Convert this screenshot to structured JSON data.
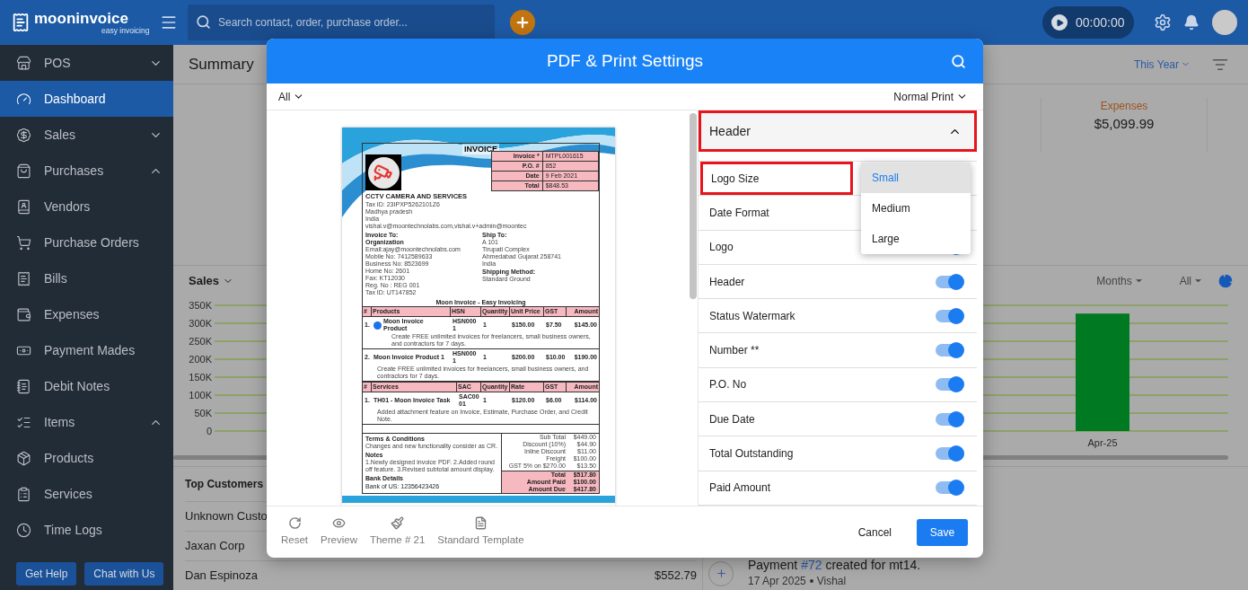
{
  "topbar": {
    "logo_name": "mooninvoice",
    "logo_tagline": "easy invoicing",
    "search_placeholder": "Search contact, order, purchase order...",
    "timer": "00:00:00"
  },
  "sidebar": {
    "items": [
      {
        "label": "POS",
        "expanded": false,
        "selected": false
      },
      {
        "label": "Dashboard",
        "selected": true
      },
      {
        "label": "Sales",
        "expanded": false,
        "selected": false
      },
      {
        "label": "Purchases",
        "expanded": true,
        "selected": false,
        "children": [
          {
            "label": "Vendors",
            "selected": false
          },
          {
            "label": "Purchase Orders",
            "selected": false
          },
          {
            "label": "Bills",
            "selected": false
          },
          {
            "label": "Expenses",
            "selected": false
          },
          {
            "label": "Payment Mades",
            "selected": false
          },
          {
            "label": "Debit Notes",
            "selected": false
          }
        ]
      },
      {
        "label": "Items",
        "expanded": true,
        "selected": false,
        "children": [
          {
            "label": "Products",
            "selected": false
          },
          {
            "label": "Services",
            "selected": false
          },
          {
            "label": "Time Logs",
            "selected": false
          }
        ]
      }
    ],
    "buttons": [
      "Get Help",
      "Chat with Us"
    ]
  },
  "summary": {
    "title": "Summary",
    "period": "This Year",
    "stats": [
      {
        "label": "Expenses",
        "value": "$5,099.99"
      }
    ]
  },
  "sales": {
    "title": "Sales",
    "period": "Months",
    "filter": "All",
    "chart_data": {
      "type": "bar",
      "grid": true,
      "categories": [
        "Apr-25"
      ],
      "values": [
        327000
      ],
      "ylim": [
        0,
        350000
      ],
      "yticks": [
        {
          "value": 0,
          "label": "0"
        },
        {
          "value": 50000,
          "label": "50K"
        },
        {
          "value": 100000,
          "label": "100K"
        },
        {
          "value": 150000,
          "label": "150K"
        },
        {
          "value": 200000,
          "label": "200K"
        },
        {
          "value": 250000,
          "label": "250K"
        },
        {
          "value": 300000,
          "label": "300K"
        },
        {
          "value": 350000,
          "label": "350K"
        }
      ]
    }
  },
  "top_customers": {
    "title": "Top Customers",
    "rows": [
      {
        "name": "Unknown Custo"
      },
      {
        "name": "Jaxan Corp"
      },
      {
        "name": "Dan Espinoza",
        "amount": "$552.79"
      }
    ]
  },
  "activity": [
    {
      "text_before": "Payment ",
      "link": "#72",
      "text_after": " created for mt14.",
      "date": "17 Apr 2025",
      "user": "Vishal"
    }
  ],
  "modal": {
    "title": "PDF & Print Settings",
    "filter": "All",
    "print_mode": "Normal Print",
    "section": {
      "title": "Header",
      "expanded": true,
      "highlighted": true
    },
    "settings": [
      {
        "label": "Logo Size",
        "kind": "select",
        "highlighted": true,
        "open": true,
        "options": [
          {
            "label": "Small",
            "selected": true
          },
          {
            "label": "Medium",
            "selected": false
          },
          {
            "label": "Large",
            "selected": false
          }
        ]
      },
      {
        "label": "Date Format",
        "kind": "select",
        "highlighted": false,
        "open": false
      },
      {
        "label": "Logo",
        "kind": "toggle",
        "highlighted": false,
        "on": true
      },
      {
        "label": "Header",
        "kind": "toggle",
        "highlighted": false,
        "on": true
      },
      {
        "label": "Status Watermark",
        "kind": "toggle",
        "highlighted": false,
        "on": true
      },
      {
        "label": "Number **",
        "kind": "toggle",
        "highlighted": false,
        "on": true
      },
      {
        "label": "P.O. No",
        "kind": "toggle",
        "highlighted": false,
        "on": true
      },
      {
        "label": "Due Date",
        "kind": "toggle",
        "highlighted": false,
        "on": true
      },
      {
        "label": "Total Outstanding",
        "kind": "toggle",
        "highlighted": false,
        "on": true
      },
      {
        "label": "Paid Amount",
        "kind": "toggle",
        "highlighted": false,
        "on": true
      }
    ],
    "tools": [
      "Reset",
      "Preview",
      "Theme # 21",
      "Standard Template"
    ],
    "cancel": "Cancel",
    "save": "Save"
  },
  "invoice": {
    "title": "INVOICE",
    "meta": [
      {
        "label": "Invoice *",
        "value": "MTPL001615"
      },
      {
        "label": "P.O. #",
        "value": "852"
      },
      {
        "label": "Date",
        "value": "9 Feb 2021"
      },
      {
        "label": "Total",
        "value": "$848.53"
      }
    ],
    "company": "CCTV CAMERA AND SERVICES",
    "company_lines": [
      "Tax ID: 23IPXP5262101Z6",
      "Madhya pradesh",
      "India",
      "vishal.v@moontechnolabs.com,vishal.v+admin@moontec"
    ],
    "bill_to": {
      "title": "Invoice To:",
      "name": "Organization",
      "lines": [
        "Email:ajay@moontechnolabs.com",
        "Mobile No: 7412589633",
        "Business No: 8523699",
        "Home No: 2601",
        "Fax: KT12030",
        "Reg. No : REG 001",
        "Tax ID: UT147852"
      ]
    },
    "ship_to": {
      "title": "Ship To:",
      "lines": [
        "A 101",
        "Tirupati Complex",
        "Ahmedabad Gujarat 258741",
        "India"
      ],
      "method_title": "Shipping Method:",
      "method": "Standard Ground"
    },
    "tagline": "Moon Invoice - Easy Invoicing",
    "products": {
      "columns": [
        "#",
        "Products",
        "HSN",
        "Quantity",
        "Unit Price",
        "GST",
        "Amount"
      ],
      "rows": [
        {
          "no": "1.",
          "name": "Moon Invoice Product",
          "code": "HSN0001",
          "qty": "1",
          "price": "$150.00",
          "gst": "$7.50",
          "amount": "$145.00",
          "desc": "Create FREE unlimited invoices for freelancers, small business owners, and contractors for 7 days.",
          "has_image": true
        },
        {
          "no": "2.",
          "name": "Moon Invoice Product 1",
          "code": "HSN0001",
          "qty": "1",
          "price": "$200.00",
          "gst": "$10.00",
          "amount": "$190.00",
          "desc": "Create FREE unlimited invoices for freelancers, small business owners, and contractors for 7 days.",
          "has_image": false
        }
      ]
    },
    "services": {
      "columns": [
        "#",
        "Services",
        "SAC",
        "Quantity",
        "Rate",
        "GST",
        "Amount"
      ],
      "rows": [
        {
          "no": "1.",
          "name": "TH01 - Moon Invoice Task",
          "code": "SAC0001",
          "qty": "1",
          "price": "$120.00",
          "gst": "$6.00",
          "amount": "$114.00",
          "desc": "Added attachment feature on Invoice, Estimate, Purchase Order, and Credit Note.",
          "has_image": false
        }
      ]
    },
    "terms_title": "Terms & Conditions",
    "terms": "Changes and new functionality consider as CR.",
    "notes_title": "Notes",
    "notes": "1.Newly designed invoice PDF. 2.Added round off feature. 3.Revised subtotal amount display.",
    "bank_title": "Bank Details",
    "bank": "Bank of US: 12356423426",
    "totals": [
      {
        "label": "Sub Total",
        "value": "$449.00",
        "highlight": false
      },
      {
        "label": "Discount (10%)",
        "value": "$44.90",
        "highlight": false
      },
      {
        "label": "Inline Discount",
        "value": "$11.00",
        "highlight": false
      },
      {
        "label": "Freight",
        "value": "$100.00",
        "highlight": false
      },
      {
        "label": "GST 5% on $270.00",
        "value": "$13.50",
        "highlight": false
      },
      {
        "label": "Total",
        "value": "$517.80",
        "highlight": true
      },
      {
        "label": "Amount Paid",
        "value": "$100.00",
        "highlight": true
      },
      {
        "label": "Amount Due",
        "value": "$417.80",
        "highlight": true
      }
    ]
  }
}
